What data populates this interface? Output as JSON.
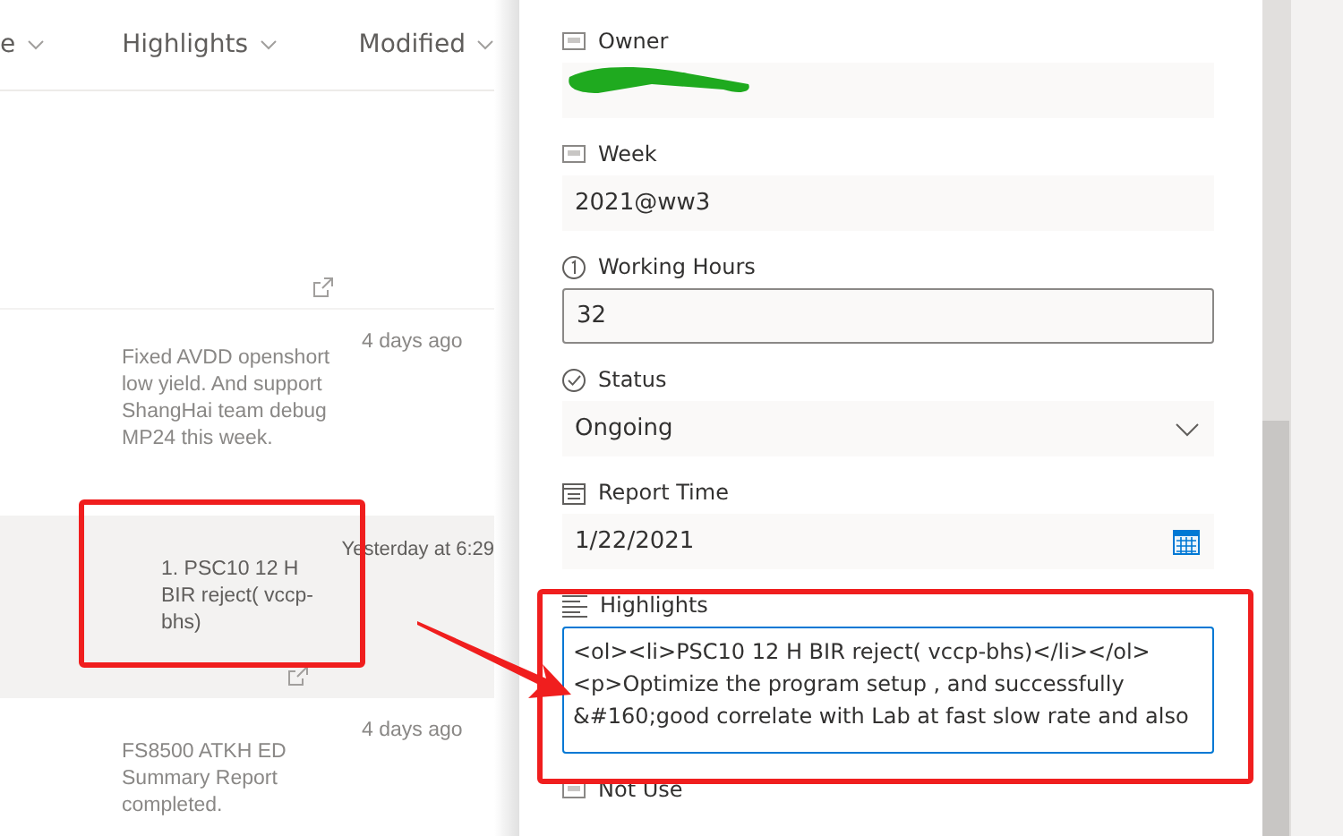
{
  "list": {
    "columns": [
      {
        "label": "e"
      },
      {
        "label": "Highlights"
      },
      {
        "label": "Modified"
      }
    ],
    "rows": [
      {
        "selected": false,
        "open_icon": true
      },
      {
        "highlights": "Fixed AVDD openshort low yield. And support ShangHai team debug MP24 this week.",
        "modified": "4 days ago",
        "selected": false,
        "open_icon": false
      },
      {
        "highlights": "1. PSC10 12 H BIR reject( vccp-bhs)",
        "modified": "Yesterday at 6:29",
        "selected": true,
        "open_icon": true
      },
      {
        "highlights": "FS8500 ATKH ED Summary Report completed.",
        "modified": "4 days ago",
        "selected": false,
        "open_icon": false
      }
    ]
  },
  "form": {
    "fields": [
      {
        "label": "Owner",
        "kind": "readonly"
      },
      {
        "label": "Week",
        "kind": "readonly",
        "value": "2021@ww3"
      },
      {
        "label": "Working Hours",
        "kind": "input",
        "value": "32"
      },
      {
        "label": "Status",
        "kind": "dropdown",
        "value": "Ongoing"
      },
      {
        "label": "Report Time",
        "kind": "date",
        "value": "1/22/2021"
      },
      {
        "label": "Highlights",
        "kind": "textarea",
        "value": "<ol><li>PSC10 12 H BIR reject( vccp-bhs)</li></ol><p>Optimize the program setup , and successfully &#160;good correlate with Lab at fast slow rate and also"
      },
      {
        "label": "Not Use",
        "kind": "label_only"
      }
    ]
  }
}
